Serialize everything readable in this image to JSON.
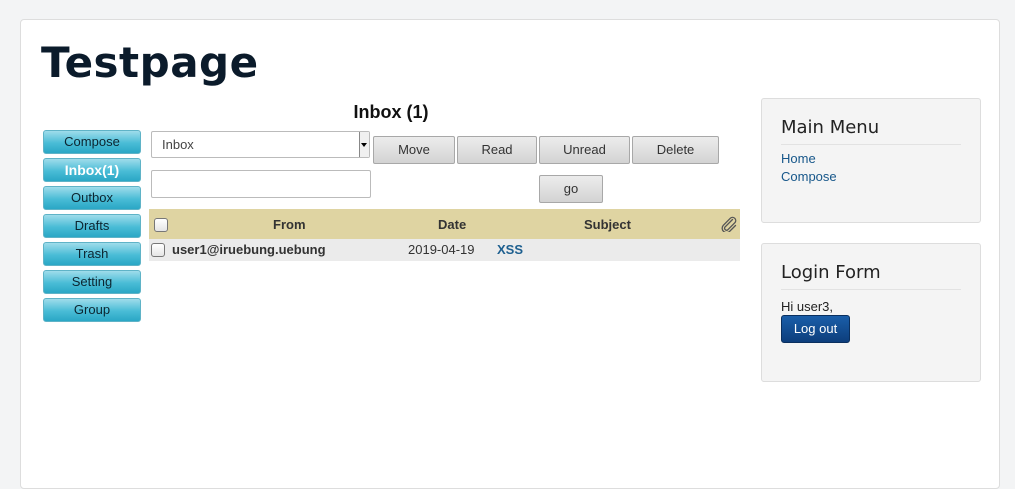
{
  "site": {
    "title": "Testpage"
  },
  "mailbox": {
    "heading": "Inbox (1)",
    "nav": [
      "Compose",
      "Inbox(1)",
      "Outbox",
      "Drafts",
      "Trash",
      "Setting",
      "Group"
    ],
    "active_nav": "Inbox(1)",
    "folder_select": {
      "value": "Inbox"
    },
    "toolbar": {
      "move": "Move",
      "read": "Read",
      "unread": "Unread",
      "delete": "Delete",
      "go": "go"
    },
    "search": {
      "value": ""
    },
    "table": {
      "headers": {
        "from": "From",
        "date": "Date",
        "subject": "Subject"
      },
      "rows": [
        {
          "from": "user1@iruebung.uebung",
          "date": "2019-04-19",
          "subject": "XSS"
        }
      ]
    }
  },
  "main_menu": {
    "title": "Main Menu",
    "links": [
      "Home",
      "Compose"
    ]
  },
  "login_form": {
    "title": "Login Form",
    "greeting": "Hi user3,",
    "logout_label": "Log out"
  },
  "colors": {
    "nav_accent": "#2aa7c5",
    "table_header": "#dfd4a2",
    "link": "#17578a",
    "logout_button": "#0d3e7c"
  },
  "icons": {
    "attachment_header": "paperclip-icon"
  }
}
